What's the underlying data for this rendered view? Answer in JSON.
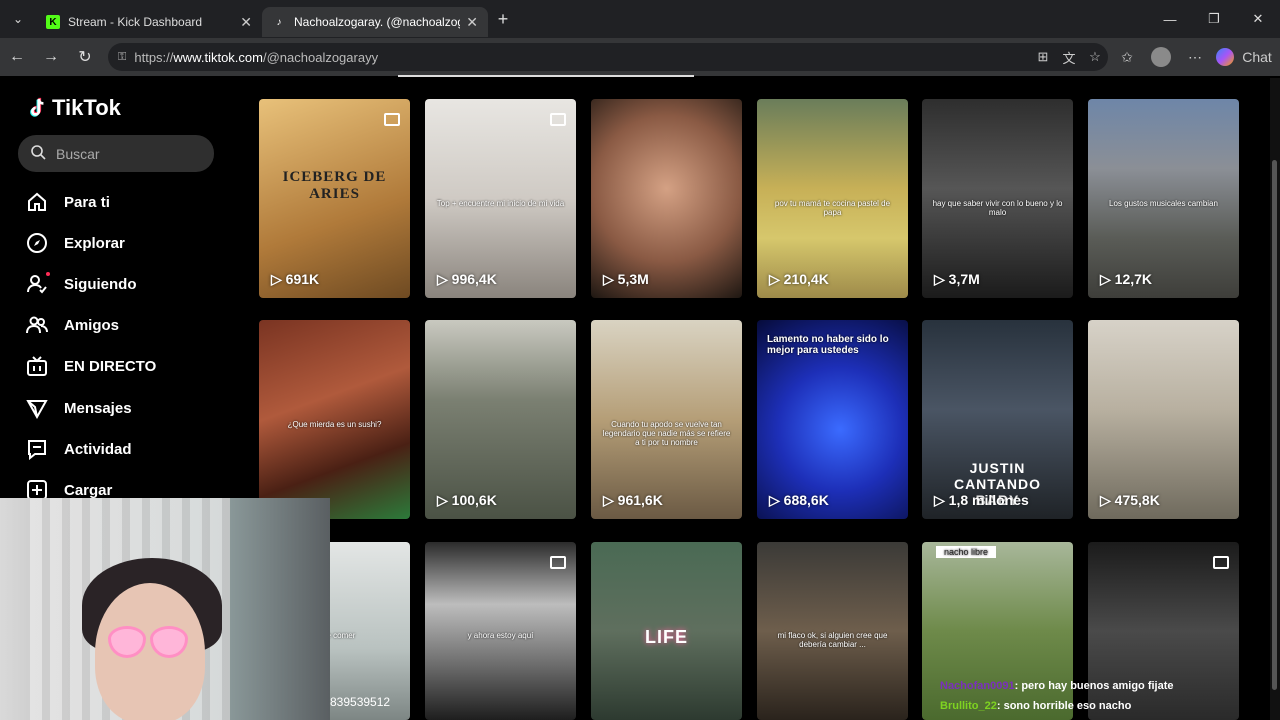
{
  "browser": {
    "tabs": [
      {
        "label": "Stream - Kick Dashboard",
        "favicon": "kick-icon",
        "active": false
      },
      {
        "label": "Nachoalzogaray. (@nachoalzoga",
        "favicon": "tiktok-icon",
        "active": true
      }
    ],
    "url_prefix": "https://",
    "url_host": "www.tiktok.com",
    "url_path": "/@nachoalzogarayy",
    "chat_label": "Chat"
  },
  "sidebar": {
    "logo": "TikTok",
    "search_placeholder": "Buscar",
    "items": [
      {
        "label": "Para ti",
        "icon": "home-icon"
      },
      {
        "label": "Explorar",
        "icon": "compass-icon"
      },
      {
        "label": "Siguiendo",
        "icon": "following-icon"
      },
      {
        "label": "Amigos",
        "icon": "friends-icon"
      },
      {
        "label": "EN DIRECTO",
        "icon": "live-icon"
      },
      {
        "label": "Mensajes",
        "icon": "send-icon"
      },
      {
        "label": "Actividad",
        "icon": "activity-icon"
      },
      {
        "label": "Cargar",
        "icon": "upload-icon"
      }
    ]
  },
  "videos": [
    {
      "views": "691K",
      "bg": "linear-gradient(160deg,#e8c17a,#b07a3a 60%,#6e4a22)",
      "title_text": "ICEBERG DE ARIES",
      "photo": true
    },
    {
      "views": "996,4K",
      "bg": "linear-gradient(180deg,#e8e6e2,#cfcac4 50%,#8a847d)",
      "caption": "Top + encuentre mi inicio de mi vida",
      "photo": true
    },
    {
      "views": "5,3M",
      "bg": "radial-gradient(circle at 50% 45%,#d4a184,#8a5a44 55%,#1e1712)"
    },
    {
      "views": "210,4K",
      "bg": "linear-gradient(180deg,#6a7d5a,#c7b057 45%,#d6c76c 70%,#9e8b4a)",
      "caption": "pov tu mamá te cocina pastel de papa"
    },
    {
      "views": "3,7M",
      "bg": "linear-gradient(180deg,#2e2e2e,#565656 45%,#1b1b1b)",
      "caption": "hay que saber vivir con lo bueno y lo malo"
    },
    {
      "views": "12,7K",
      "bg": "linear-gradient(180deg,#6e86a8,#8b8f96 35%,#5a5c57 70%,#3e3e3a)",
      "caption": "Los gustos musicales cambian"
    },
    {
      "views": "",
      "bg": "linear-gradient(160deg,#7a3422,#b05a3c 40%,#4a2014 70%,#2c7a3a)",
      "caption": "¿Que mierda es un sushi?"
    },
    {
      "views": "100,6K",
      "bg": "linear-gradient(180deg,#c9c9c0,#7b8072 40%,#4b5245)"
    },
    {
      "views": "961,6K",
      "bg": "linear-gradient(180deg,#d9d3c2,#b59e77 50%,#6b5a44)",
      "caption": "Cuando tu apodo se vuelve tan legendario que nadie más se refiere a ti por tu nombre"
    },
    {
      "views": "688,6K",
      "bg": "radial-gradient(circle at 55% 55%,#3b6bff,#1d2fb8 45%,#060b3a)",
      "caption_top": "Lamento no haber sido lo mejor para ustedes"
    },
    {
      "views": "1,8 millones",
      "bg": "linear-gradient(180deg,#28323d,#4a5564 45%,#1f2327)",
      "title_text2": "JUSTIN CANTANDO BABY"
    },
    {
      "views": "475,8K",
      "bg": "linear-gradient(180deg,#d7d2c8,#b8b0a0 45%,#6f6a5d)"
    },
    {
      "views": "",
      "bg": "linear-gradient(180deg,#e3e6e5,#b9c2c0 60%,#7d8684)",
      "caption": "la de comer"
    },
    {
      "views": "",
      "bg": "linear-gradient(180deg,#2b2b2b,#bdbdbd 35%,#6a6a6a 70%,#1e1e1e)",
      "caption": "y ahora estoy aquí",
      "photo": true
    },
    {
      "views": "",
      "bg": "linear-gradient(180deg,#4a6a54,#5f6f5e 50%,#2d3a30)",
      "title_text3": "LIFE"
    },
    {
      "views": "",
      "bg": "linear-gradient(180deg,#3b3a37,#6e5e4c 50%,#2a231c)",
      "caption": "mi flaco ok, si alguien cree que debería cambiar ..."
    },
    {
      "views": "",
      "bg": "linear-gradient(180deg,#a8b79a,#6e8a4a 50%,#4b6a2e)",
      "caption_box": "nacho libre"
    },
    {
      "views": "",
      "bg": "linear-gradient(180deg,#1b1b1b,#4a4a4a 50%,#2a2a2a)",
      "photo": true
    }
  ],
  "overlay": {
    "partial_number": "839539512",
    "chat": [
      {
        "user": "Nachofan0091",
        "msg": ": pero hay buenos amigo fijate"
      },
      {
        "user": "Brullito_22",
        "msg": ": sono horrible eso nacho"
      }
    ]
  }
}
